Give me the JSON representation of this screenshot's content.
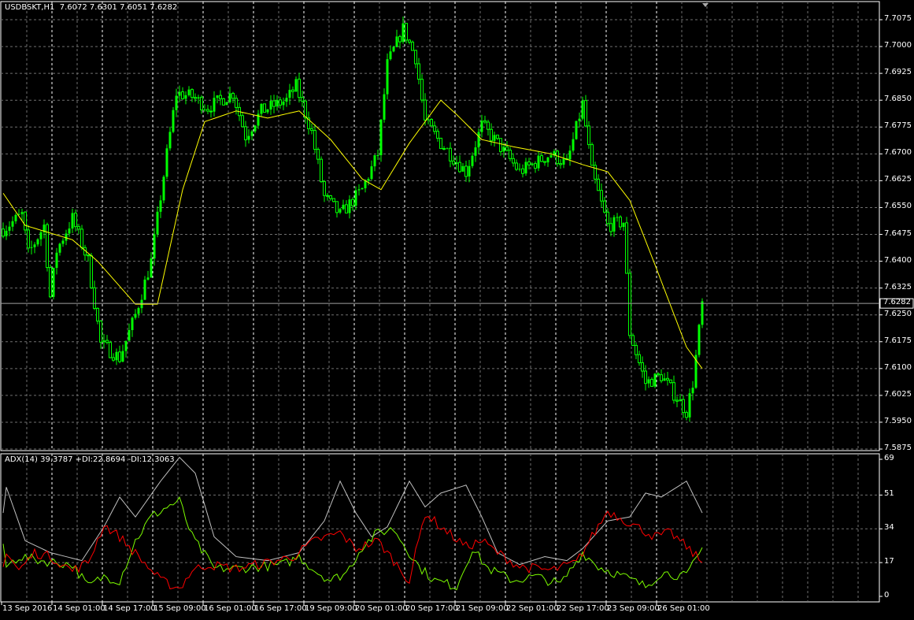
{
  "header": {
    "symbol": "USDBSKT,H1",
    "open": "7.6072",
    "high": "7.6301",
    "low": "7.6051",
    "close": "7.6282"
  },
  "indicator_header": {
    "adx": "ADX(14) 39.3787",
    "plus_di": "+DI:22.8694",
    "minus_di": "-DI:12.3063"
  },
  "colors": {
    "background": "#000000",
    "candle": "#00ff00",
    "ma": "#ffff00",
    "adx": "#c0c0c0",
    "plus_di": "#7cfc00",
    "minus_di": "#ff0000",
    "grid": "#707070"
  },
  "chart_data": [
    {
      "type": "candlestick",
      "title": "USDBSKT,H1",
      "ylim": [
        7.5875,
        7.7075
      ],
      "y_ticks": [
        "7.7075",
        "7.7000",
        "7.6925",
        "7.6850",
        "7.6775",
        "7.6700",
        "7.6625",
        "7.6550",
        "7.6475",
        "7.6400",
        "7.6325",
        "7.6250",
        "7.6175",
        "7.6100",
        "7.6025",
        "7.5950",
        "7.5875"
      ],
      "current_price": "7.6282",
      "x_ticks": [
        "13 Sep 2016",
        "14 Sep 01:00",
        "14 Sep 17:00",
        "15 Sep 09:00",
        "16 Sep 01:00",
        "16 Sep 17:00",
        "19 Sep 09:00",
        "20 Sep 01:00",
        "20 Sep 17:00",
        "21 Sep 09:00",
        "22 Sep 01:00",
        "22 Sep 17:00",
        "23 Sep 09:00",
        "26 Sep 01:00"
      ],
      "bars": 223,
      "close_path": [
        [
          0,
          7.649
        ],
        [
          6,
          7.653
        ],
        [
          8,
          7.642
        ],
        [
          13,
          7.65
        ],
        [
          15,
          7.63
        ],
        [
          17,
          7.643
        ],
        [
          22,
          7.652
        ],
        [
          27,
          7.64
        ],
        [
          31,
          7.617
        ],
        [
          37,
          7.613
        ],
        [
          42,
          7.625
        ],
        [
          47,
          7.64
        ],
        [
          52,
          7.67
        ],
        [
          55,
          7.687
        ],
        [
          60,
          7.686
        ],
        [
          65,
          7.683
        ],
        [
          73,
          7.687
        ],
        [
          77,
          7.675
        ],
        [
          82,
          7.682
        ],
        [
          90,
          7.685
        ],
        [
          93,
          7.689
        ],
        [
          98,
          7.676
        ],
        [
          102,
          7.658
        ],
        [
          107,
          7.653
        ],
        [
          114,
          7.66
        ],
        [
          119,
          7.67
        ],
        [
          122,
          7.695
        ],
        [
          127,
          7.705
        ],
        [
          131,
          7.697
        ],
        [
          134,
          7.679
        ],
        [
          139,
          7.673
        ],
        [
          147,
          7.665
        ],
        [
          152,
          7.678
        ],
        [
          157,
          7.673
        ],
        [
          164,
          7.665
        ],
        [
          174,
          7.67
        ],
        [
          179,
          7.667
        ],
        [
          184,
          7.684
        ],
        [
          187,
          7.665
        ],
        [
          192,
          7.65
        ],
        [
          197,
          7.651
        ],
        [
          199,
          7.62
        ],
        [
          204,
          7.606
        ],
        [
          209,
          7.608
        ],
        [
          217,
          7.598
        ],
        [
          219,
          7.606
        ],
        [
          222,
          7.628
        ]
      ],
      "ma_path": [
        [
          0,
          7.659
        ],
        [
          7,
          7.65
        ],
        [
          22,
          7.646
        ],
        [
          30,
          7.64
        ],
        [
          42,
          7.628
        ],
        [
          49,
          7.628
        ],
        [
          57,
          7.66
        ],
        [
          64,
          7.679
        ],
        [
          74,
          7.682
        ],
        [
          84,
          7.68
        ],
        [
          94,
          7.682
        ],
        [
          104,
          7.674
        ],
        [
          114,
          7.663
        ],
        [
          120,
          7.66
        ],
        [
          129,
          7.673
        ],
        [
          139,
          7.685
        ],
        [
          144,
          7.681
        ],
        [
          152,
          7.674
        ],
        [
          162,
          7.672
        ],
        [
          174,
          7.67
        ],
        [
          184,
          7.667
        ],
        [
          192,
          7.665
        ],
        [
          199,
          7.657
        ],
        [
          207,
          7.639
        ],
        [
          217,
          7.616
        ],
        [
          222,
          7.61
        ]
      ]
    },
    {
      "type": "line",
      "title": "ADX(14)",
      "ylim": [
        0,
        69
      ],
      "y_ticks": [
        "69",
        "51",
        "34",
        "17",
        "0"
      ],
      "series": [
        {
          "name": "ADX",
          "path": [
            [
              1,
              55
            ],
            [
              7,
              28
            ],
            [
              15,
              22
            ],
            [
              25,
              18
            ],
            [
              32,
              35
            ],
            [
              37,
              50
            ],
            [
              42,
              40
            ],
            [
              50,
              58
            ],
            [
              56,
              70
            ],
            [
              61,
              62
            ],
            [
              67,
              30
            ],
            [
              74,
              20
            ],
            [
              84,
              18
            ],
            [
              94,
              22
            ],
            [
              102,
              38
            ],
            [
              107,
              58
            ],
            [
              112,
              42
            ],
            [
              117,
              30
            ],
            [
              122,
              35
            ],
            [
              129,
              58
            ],
            [
              134,
              45
            ],
            [
              139,
              52
            ],
            [
              147,
              56
            ],
            [
              152,
              40
            ],
            [
              157,
              22
            ],
            [
              164,
              16
            ],
            [
              172,
              20
            ],
            [
              179,
              18
            ],
            [
              184,
              24
            ],
            [
              192,
              38
            ],
            [
              199,
              40
            ],
            [
              204,
              52
            ],
            [
              209,
              50
            ],
            [
              217,
              58
            ],
            [
              222,
              42
            ]
          ]
        },
        {
          "name": "+DI",
          "path": [
            [
              1,
              15
            ],
            [
              5,
              20
            ],
            [
              12,
              18
            ],
            [
              22,
              16
            ],
            [
              27,
              5
            ],
            [
              32,
              10
            ],
            [
              37,
              8
            ],
            [
              42,
              28
            ],
            [
              47,
              40
            ],
            [
              52,
              45
            ],
            [
              56,
              48
            ],
            [
              60,
              30
            ],
            [
              67,
              14
            ],
            [
              74,
              14
            ],
            [
              82,
              15
            ],
            [
              89,
              16
            ],
            [
              94,
              20
            ],
            [
              99,
              13
            ],
            [
              104,
              8
            ],
            [
              109,
              12
            ],
            [
              114,
              25
            ],
            [
              119,
              32
            ],
            [
              124,
              34
            ],
            [
              132,
              15
            ],
            [
              137,
              8
            ],
            [
              144,
              5
            ],
            [
              149,
              24
            ],
            [
              154,
              14
            ],
            [
              162,
              8
            ],
            [
              169,
              10
            ],
            [
              177,
              6
            ],
            [
              184,
              22
            ],
            [
              189,
              15
            ],
            [
              197,
              10
            ],
            [
              204,
              5
            ],
            [
              209,
              12
            ],
            [
              217,
              10
            ],
            [
              222,
              24
            ]
          ]
        },
        {
          "name": "-DI",
          "path": [
            [
              1,
              22
            ],
            [
              5,
              13
            ],
            [
              10,
              22
            ],
            [
              15,
              20
            ],
            [
              22,
              13
            ],
            [
              27,
              17
            ],
            [
              32,
              36
            ],
            [
              37,
              30
            ],
            [
              43,
              20
            ],
            [
              50,
              8
            ],
            [
              56,
              4
            ],
            [
              60,
              13
            ],
            [
              65,
              16
            ],
            [
              74,
              14
            ],
            [
              84,
              17
            ],
            [
              92,
              20
            ],
            [
              99,
              28
            ],
            [
              107,
              32
            ],
            [
              112,
              24
            ],
            [
              119,
              28
            ],
            [
              124,
              18
            ],
            [
              129,
              8
            ],
            [
              134,
              42
            ],
            [
              139,
              35
            ],
            [
              147,
              25
            ],
            [
              152,
              28
            ],
            [
              157,
              22
            ],
            [
              164,
              15
            ],
            [
              174,
              13
            ],
            [
              182,
              17
            ],
            [
              192,
              43
            ],
            [
              199,
              37
            ],
            [
              207,
              30
            ],
            [
              212,
              32
            ],
            [
              217,
              25
            ],
            [
              222,
              17
            ]
          ]
        }
      ]
    }
  ]
}
